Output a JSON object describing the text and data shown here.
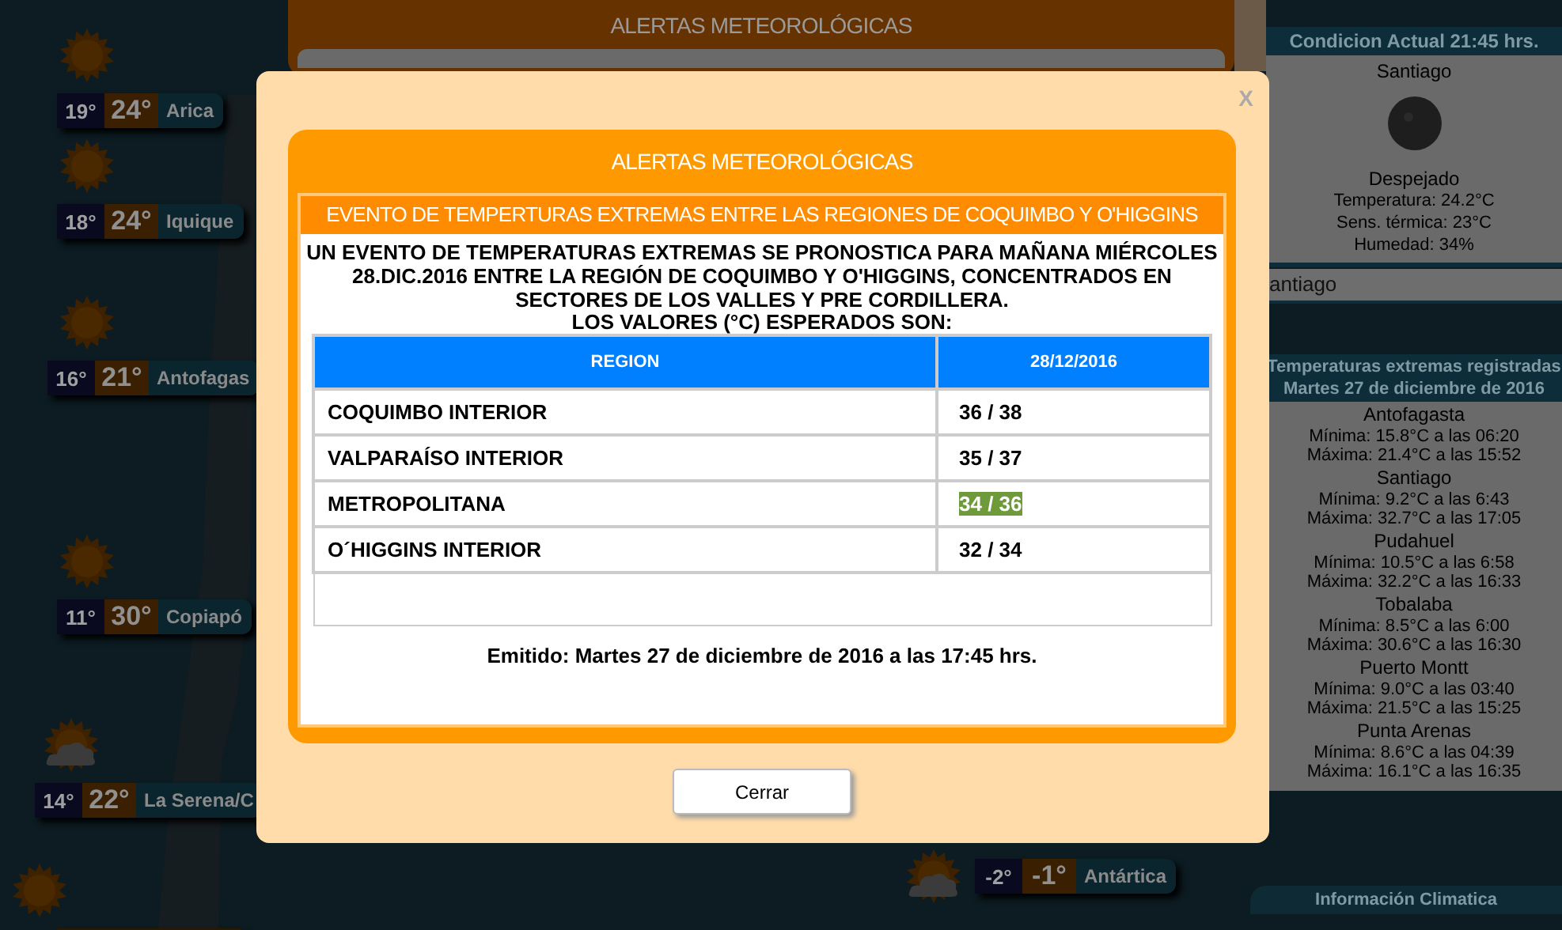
{
  "background_page": {
    "map_cities": [
      {
        "kind": "sunny",
        "min": "19°",
        "max": "24°",
        "name": "Arica"
      },
      {
        "kind": "sunny",
        "min": "18°",
        "max": "24°",
        "name": "Iquique"
      },
      {
        "kind": "sunny",
        "min": "16°",
        "max": "21°",
        "name": "Antofagas"
      },
      {
        "kind": "sunny",
        "min": "11°",
        "max": "30°",
        "name": "Copiapó"
      },
      {
        "kind": "partly_cloudy",
        "min": "14°",
        "max": "22°",
        "name": "La Serena/C"
      },
      {
        "kind": "sunny"
      },
      {
        "kind": "partly_cloudy",
        "min": "-2°",
        "max": "-1°",
        "name": "Antártica"
      }
    ],
    "alerts_panel": {
      "title": "ALERTAS METEOROLÓGICAS"
    },
    "current_conditions": {
      "title": "Condicion Actual 21:45 hrs.",
      "station": "Santiago",
      "condition": "Despejado",
      "lines": [
        "Temperatura: 24.2°C",
        "Sens. térmica: 23°C",
        "Humedad: 34%"
      ]
    },
    "station_field": {
      "value": "antiago"
    },
    "extremes": {
      "title": "Temperaturas extremas registradas",
      "date": "Martes 27 de diciembre de 2016",
      "stations": [
        {
          "name": "Antofagasta",
          "min": "Mínima: 15.8°C a las 06:20",
          "max": "Máxima: 21.4°C a las 15:52"
        },
        {
          "name": "Santiago",
          "min": "Mínima: 9.2°C a las 6:43",
          "max": "Máxima: 32.7°C a las 17:05"
        },
        {
          "name": "Pudahuel",
          "min": "Mínima: 10.5°C a las 6:58",
          "max": "Máxima: 32.2°C a las 16:33"
        },
        {
          "name": "Tobalaba",
          "min": "Mínima: 8.5°C a las 6:00",
          "max": "Máxima: 30.6°C a las 16:30"
        },
        {
          "name": "Puerto Montt",
          "min": "Mínima: 9.0°C a las 03:40",
          "max": "Máxima: 21.5°C a las 15:25"
        },
        {
          "name": "Punta Arenas",
          "min": "Mínima: 8.6°C a las 04:39",
          "max": "Máxima: 16.1°C a las 16:35"
        }
      ]
    },
    "climate_info": {
      "title": "Información Climatica"
    }
  },
  "modal": {
    "close": "X",
    "title": "ALERTAS METEOROLÓGICAS",
    "alert_heading": "EVENTO DE TEMPERTURAS EXTREMAS ENTRE LAS REGIONES DE COQUIMBO Y O'HIGGINS",
    "description": "UN EVENTO DE TEMPERATURAS EXTREMAS SE PRONOSTICA PARA MAÑANA MIÉRCOLES 28.DIC.2016 ENTRE LA REGIÓN DE COQUIMBO Y O'HIGGINS, CONCENTRADOS EN SECTORES DE LOS VALLES Y PRE CORDILLERA.",
    "values_intro": "LOS VALORES (°C) ESPERADOS SON:",
    "table": {
      "columns": [
        "REGION",
        "28/12/2016"
      ],
      "rows": [
        {
          "region": "COQUIMBO INTERIOR",
          "value": "36 / 38",
          "highlighted": false
        },
        {
          "region": "VALPARAÍSO INTERIOR",
          "value": "35 / 37",
          "highlighted": false
        },
        {
          "region": "METROPOLITANA",
          "value": "34 / 36",
          "highlighted": true
        },
        {
          "region": "O´HIGGINS INTERIOR",
          "value": "32 / 34",
          "highlighted": false
        }
      ]
    },
    "issued": "Emitido: Martes 27 de diciembre de 2016 a las 17:45 hrs.",
    "button": "Cerrar"
  }
}
